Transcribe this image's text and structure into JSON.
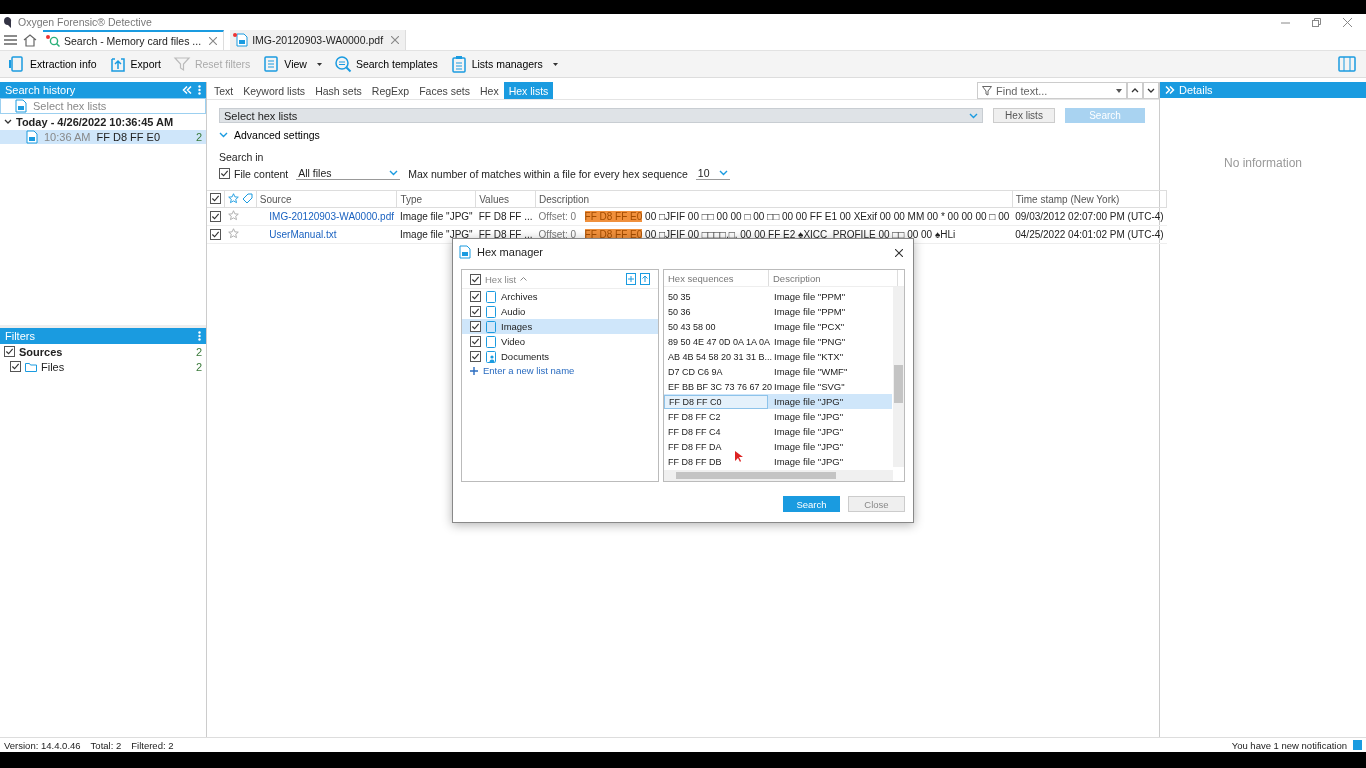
{
  "window": {
    "title": "Oxygen Forensic® Detective"
  },
  "doc_tabs": [
    {
      "label": "Search - Memory card files ...",
      "selected": true
    },
    {
      "label": "IMG-20120903-WA0000.pdf",
      "selected": false
    }
  ],
  "toolbar": [
    {
      "label": "Extraction info",
      "disabled": false,
      "dropdown": false
    },
    {
      "label": "Export",
      "disabled": false,
      "dropdown": false
    },
    {
      "label": "Reset filters",
      "disabled": true,
      "dropdown": false
    },
    {
      "label": "View",
      "disabled": false,
      "dropdown": true
    },
    {
      "label": "Search templates",
      "disabled": false,
      "dropdown": false
    },
    {
      "label": "Lists managers",
      "disabled": false,
      "dropdown": true
    }
  ],
  "search_history": {
    "title": "Search history",
    "placeholder": "Select hex lists",
    "group": "Today - 4/26/2022 10:36:45 AM",
    "items": [
      {
        "time": "10:36 AM",
        "query": "FF D8 FF E0",
        "count": "2",
        "selected": true
      }
    ]
  },
  "filters": {
    "title": "Filters",
    "items": [
      {
        "label": "Sources",
        "count": "2",
        "checked": true,
        "children": [
          {
            "label": "Files",
            "count": "2",
            "checked": true
          }
        ]
      }
    ]
  },
  "search_tabs": [
    {
      "label": "Text",
      "selected": false
    },
    {
      "label": "Keyword lists",
      "selected": false
    },
    {
      "label": "Hash sets",
      "selected": false
    },
    {
      "label": "RegExp",
      "selected": false
    },
    {
      "label": "Faces sets",
      "selected": false
    },
    {
      "label": "Hex",
      "selected": false
    },
    {
      "label": "Hex lists",
      "selected": true
    }
  ],
  "find": {
    "placeholder": "Find text..."
  },
  "hex_select": {
    "placeholder": "Select hex lists"
  },
  "hex_lists_button": "Hex lists",
  "search_button": {
    "label": "Search",
    "disabled": true
  },
  "advanced_settings": {
    "label": "Advanced settings",
    "expanded": true
  },
  "search_in": {
    "label": "Search in",
    "file_content": {
      "label": "File content",
      "checked": true
    },
    "scope": "All files",
    "max_label": "Max number of matches within a file for every hex sequence",
    "max_value": "10"
  },
  "table": {
    "all_checked": true,
    "columns": [
      "Source",
      "Type",
      "Values",
      "Description",
      "Time stamp (New York)"
    ],
    "rows": [
      {
        "checked": true,
        "starred": false,
        "source": "IMG-20120903-WA0000.pdf",
        "type": "Image file \"JPG\"",
        "values": "FF D8 FF ...",
        "offset": "Offset: 0",
        "match": "FF D8 FF E0",
        "rest": "00 □JFIF 00 □□ 00 00 □ 00 □□ 00 00 FF E1 00 XExif 00 00 MM 00 * 00 00 00 □ 00",
        "timestamp": "09/03/2012 02:07:00 PM (UTC-4)"
      },
      {
        "checked": true,
        "starred": false,
        "source": "UserManual.txt",
        "type": "Image file \"JPG\"",
        "values": "FF D8 FF ...",
        "offset": "Offset: 0",
        "match": "FF D8 FF E0",
        "rest": "00 □JFIF 00 □□□□,□, 00 00 FF E2 ♠XICC_PROFILE 00 □□ 00 00 ♠HLi",
        "timestamp": "04/25/2022 04:01:02 PM (UTC-4)"
      }
    ]
  },
  "details": {
    "title": "Details",
    "empty": "No information"
  },
  "status_bar": {
    "version": "Version: 14.4.0.46",
    "total": "Total: 2",
    "filtered": "Filtered: 2",
    "notification": "You have 1 new notification"
  },
  "dialog": {
    "title": "Hex manager",
    "list_header": "Hex list",
    "all_checked": true,
    "lists": [
      {
        "label": "Archives",
        "checked": true,
        "selected": false,
        "kind": "file"
      },
      {
        "label": "Audio",
        "checked": true,
        "selected": false,
        "kind": "file"
      },
      {
        "label": "Images",
        "checked": true,
        "selected": true,
        "kind": "file"
      },
      {
        "label": "Video",
        "checked": true,
        "selected": false,
        "kind": "file"
      },
      {
        "label": "Documents",
        "checked": true,
        "selected": false,
        "kind": "user"
      }
    ],
    "add_link": "Enter a new list name",
    "columns": [
      "Hex sequences",
      "Description"
    ],
    "sequences": [
      {
        "hex": "50 35",
        "description": "Image file \"PPM\"",
        "selected": false
      },
      {
        "hex": "50 36",
        "description": "Image file \"PPM\"",
        "selected": false
      },
      {
        "hex": "50 43 58 00",
        "description": "Image file \"PCX\"",
        "selected": false
      },
      {
        "hex": "89 50 4E 47 0D 0A 1A 0A",
        "description": "Image file \"PNG\"",
        "selected": false
      },
      {
        "hex": "AB 4B 54 58 20 31 31 B...",
        "description": "Image file \"KTX\"",
        "selected": false
      },
      {
        "hex": "D7 CD C6 9A",
        "description": "Image file \"WMF\"",
        "selected": false
      },
      {
        "hex": "EF BB BF 3C 73 76 67 20",
        "description": "Image file \"SVG\"",
        "selected": false
      },
      {
        "hex": "FF D8 FF C0",
        "description": "Image file \"JPG\"",
        "selected": true
      },
      {
        "hex": "FF D8 FF C2",
        "description": "Image file \"JPG\"",
        "selected": false
      },
      {
        "hex": "FF D8 FF C4",
        "description": "Image file \"JPG\"",
        "selected": false
      },
      {
        "hex": "FF D8 FF DA",
        "description": "Image file \"JPG\"",
        "selected": false
      },
      {
        "hex": "FF D8 FF DB",
        "description": "Image file \"JPG\"",
        "selected": false
      }
    ],
    "buttons": {
      "primary": "Search",
      "secondary": "Close"
    }
  }
}
